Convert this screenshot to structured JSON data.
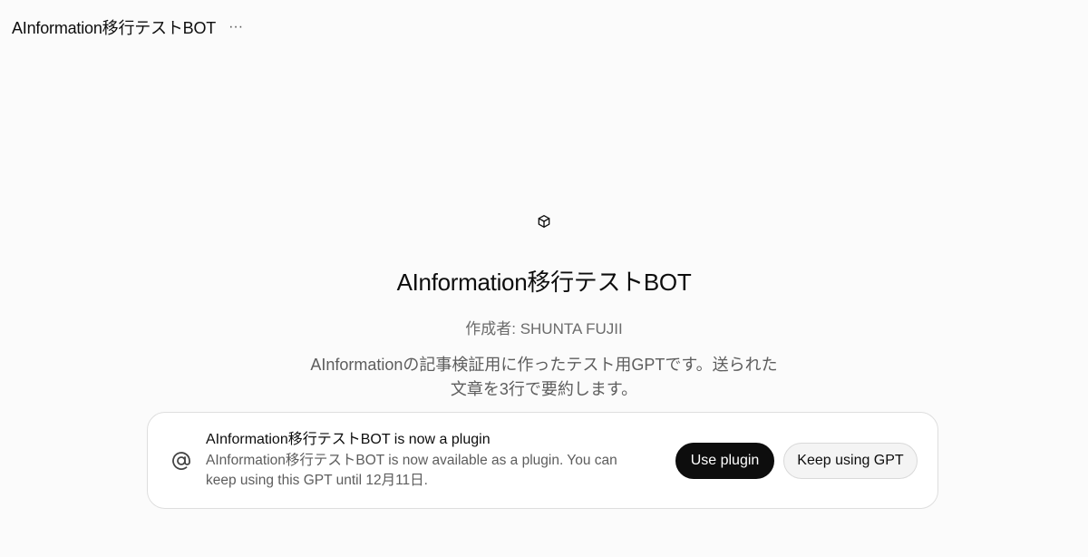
{
  "header": {
    "title": "AInformation移行テストBOT",
    "more_icon": "ellipsis-icon",
    "more_label": "···"
  },
  "gpt": {
    "icon": "cube-icon",
    "title": "AInformation移行テストBOT",
    "author": "作成者: SHUNTA FUJII",
    "description": "AInformationの記事検証用に作ったテスト用GPTです。送られた文章を3行で要約します。"
  },
  "banner": {
    "icon": "at-sign-icon",
    "title": "AInformation移行テストBOT is now a plugin",
    "body": "AInformation移行テストBOT is now available as a plugin. You can keep using this GPT until 12月11日.",
    "use_plugin_label": "Use plugin",
    "keep_gpt_label": "Keep using GPT"
  },
  "colors": {
    "background": "#fbfbfb",
    "primary_button": "#0d0d0d",
    "secondary_button": "#f4f4f4",
    "muted_text": "#6b6b6b"
  }
}
